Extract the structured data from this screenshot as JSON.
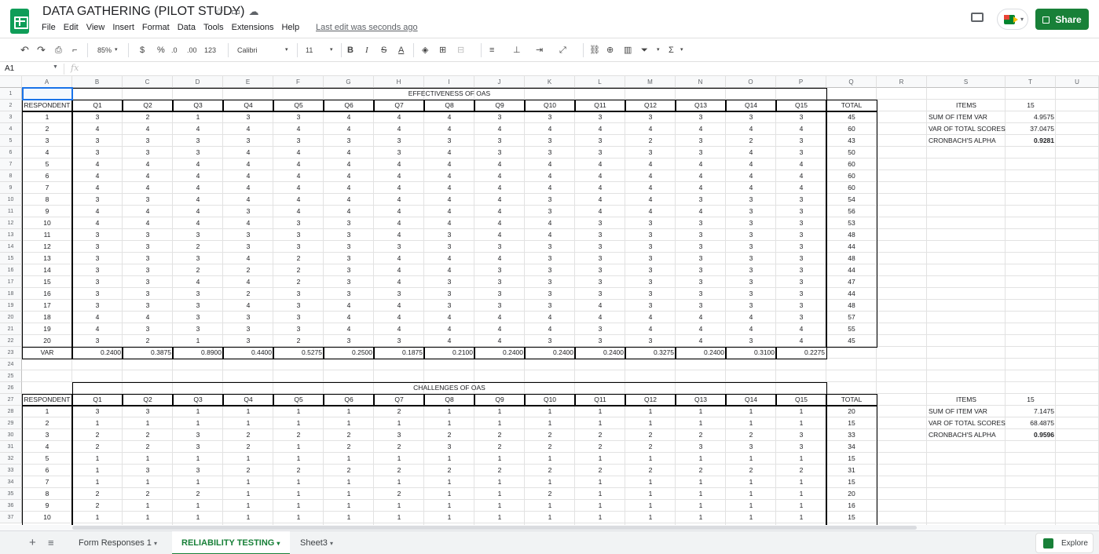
{
  "app": {
    "title": "DATA GATHERING (PILOT STUDY)",
    "menu": [
      "File",
      "Edit",
      "View",
      "Insert",
      "Format",
      "Data",
      "Tools",
      "Extensions",
      "Help"
    ],
    "last_edit": "Last edit was seconds ago",
    "share_label": "Share",
    "accent": "#188038"
  },
  "toolbar": {
    "zoom": "85%",
    "currency": "$",
    "percent": "%",
    "dec_less": ".0",
    "dec_more": ".00",
    "format_more": "123",
    "font": "Calibri",
    "font_size": "11"
  },
  "formula_bar": {
    "cell_ref": "A1",
    "fx": "fx"
  },
  "columns": [
    "A",
    "B",
    "C",
    "D",
    "E",
    "F",
    "G",
    "H",
    "I",
    "J",
    "K",
    "L",
    "M",
    "N",
    "O",
    "P",
    "Q",
    "R",
    "S",
    "T",
    "U"
  ],
  "rows": [
    "1",
    "2",
    "3",
    "4",
    "5",
    "6",
    "7",
    "8",
    "9",
    "10",
    "11",
    "12",
    "13",
    "14",
    "15",
    "16",
    "17",
    "18",
    "19",
    "20",
    "21",
    "22",
    "23",
    "24",
    "25",
    "26",
    "27",
    "28",
    "29",
    "30",
    "31",
    "32",
    "33",
    "34",
    "35",
    "36",
    "37"
  ],
  "table1": {
    "title": "EFFECTIVENESS OF OAS",
    "headers": [
      "RESPONDENT",
      "Q1",
      "Q2",
      "Q3",
      "Q4",
      "Q5",
      "Q6",
      "Q7",
      "Q8",
      "Q9",
      "Q10",
      "Q11",
      "Q12",
      "Q13",
      "Q14",
      "Q15",
      "TOTAL"
    ],
    "rows": [
      [
        "1",
        "3",
        "2",
        "1",
        "3",
        "3",
        "4",
        "4",
        "4",
        "3",
        "3",
        "3",
        "3",
        "3",
        "3",
        "3",
        "45"
      ],
      [
        "2",
        "4",
        "4",
        "4",
        "4",
        "4",
        "4",
        "4",
        "4",
        "4",
        "4",
        "4",
        "4",
        "4",
        "4",
        "4",
        "60"
      ],
      [
        "3",
        "3",
        "3",
        "3",
        "3",
        "3",
        "3",
        "3",
        "3",
        "3",
        "3",
        "3",
        "2",
        "3",
        "2",
        "3",
        "43"
      ],
      [
        "4",
        "3",
        "3",
        "3",
        "4",
        "4",
        "4",
        "3",
        "4",
        "3",
        "3",
        "3",
        "3",
        "3",
        "4",
        "3",
        "50"
      ],
      [
        "5",
        "4",
        "4",
        "4",
        "4",
        "4",
        "4",
        "4",
        "4",
        "4",
        "4",
        "4",
        "4",
        "4",
        "4",
        "4",
        "60"
      ],
      [
        "6",
        "4",
        "4",
        "4",
        "4",
        "4",
        "4",
        "4",
        "4",
        "4",
        "4",
        "4",
        "4",
        "4",
        "4",
        "4",
        "60"
      ],
      [
        "7",
        "4",
        "4",
        "4",
        "4",
        "4",
        "4",
        "4",
        "4",
        "4",
        "4",
        "4",
        "4",
        "4",
        "4",
        "4",
        "60"
      ],
      [
        "8",
        "3",
        "3",
        "4",
        "4",
        "4",
        "4",
        "4",
        "4",
        "4",
        "3",
        "4",
        "4",
        "3",
        "3",
        "3",
        "54"
      ],
      [
        "9",
        "4",
        "4",
        "4",
        "3",
        "4",
        "4",
        "4",
        "4",
        "4",
        "3",
        "4",
        "4",
        "4",
        "3",
        "3",
        "56"
      ],
      [
        "10",
        "4",
        "4",
        "4",
        "4",
        "3",
        "3",
        "4",
        "4",
        "4",
        "4",
        "3",
        "3",
        "3",
        "3",
        "3",
        "53"
      ],
      [
        "11",
        "3",
        "3",
        "3",
        "3",
        "3",
        "3",
        "4",
        "3",
        "4",
        "4",
        "3",
        "3",
        "3",
        "3",
        "3",
        "48"
      ],
      [
        "12",
        "3",
        "3",
        "2",
        "3",
        "3",
        "3",
        "3",
        "3",
        "3",
        "3",
        "3",
        "3",
        "3",
        "3",
        "3",
        "44"
      ],
      [
        "13",
        "3",
        "3",
        "3",
        "4",
        "2",
        "3",
        "4",
        "4",
        "4",
        "3",
        "3",
        "3",
        "3",
        "3",
        "3",
        "48"
      ],
      [
        "14",
        "3",
        "3",
        "2",
        "2",
        "2",
        "3",
        "4",
        "4",
        "3",
        "3",
        "3",
        "3",
        "3",
        "3",
        "3",
        "44"
      ],
      [
        "15",
        "3",
        "3",
        "4",
        "4",
        "2",
        "3",
        "4",
        "3",
        "3",
        "3",
        "3",
        "3",
        "3",
        "3",
        "3",
        "47"
      ],
      [
        "16",
        "3",
        "3",
        "3",
        "2",
        "3",
        "3",
        "3",
        "3",
        "3",
        "3",
        "3",
        "3",
        "3",
        "3",
        "3",
        "44"
      ],
      [
        "17",
        "3",
        "3",
        "3",
        "4",
        "3",
        "4",
        "4",
        "3",
        "3",
        "3",
        "4",
        "3",
        "3",
        "3",
        "3",
        "48"
      ],
      [
        "18",
        "4",
        "4",
        "3",
        "3",
        "3",
        "4",
        "4",
        "4",
        "4",
        "4",
        "4",
        "4",
        "4",
        "4",
        "3",
        "57"
      ],
      [
        "19",
        "4",
        "3",
        "3",
        "3",
        "3",
        "4",
        "4",
        "4",
        "4",
        "4",
        "3",
        "4",
        "4",
        "4",
        "4",
        "55"
      ],
      [
        "20",
        "3",
        "2",
        "1",
        "3",
        "2",
        "3",
        "3",
        "4",
        "4",
        "3",
        "3",
        "3",
        "4",
        "3",
        "4",
        "45"
      ]
    ],
    "var_label": "VAR",
    "var_values": [
      "0.2400",
      "0.3875",
      "0.8900",
      "0.4400",
      "0.5275",
      "0.2500",
      "0.1875",
      "0.2100",
      "0.2400",
      "0.2400",
      "0.2400",
      "0.3275",
      "0.2400",
      "0.3100",
      "0.2275"
    ]
  },
  "stats1": [
    {
      "label": "ITEMS",
      "value": "15"
    },
    {
      "label": "SUM OF ITEM VAR",
      "value": "4.9575"
    },
    {
      "label": "VAR OF TOTAL SCORES",
      "value": "37.0475"
    },
    {
      "label": "CRONBACH'S ALPHA",
      "value": "0.9281"
    }
  ],
  "table2": {
    "title": "CHALLENGES OF OAS",
    "headers": [
      "RESPONDENT",
      "Q1",
      "Q2",
      "Q3",
      "Q4",
      "Q5",
      "Q6",
      "Q7",
      "Q8",
      "Q9",
      "Q10",
      "Q11",
      "Q12",
      "Q13",
      "Q14",
      "Q15",
      "TOTAL"
    ],
    "rows": [
      [
        "1",
        "3",
        "3",
        "1",
        "1",
        "1",
        "1",
        "2",
        "1",
        "1",
        "1",
        "1",
        "1",
        "1",
        "1",
        "1",
        "20"
      ],
      [
        "2",
        "1",
        "1",
        "1",
        "1",
        "1",
        "1",
        "1",
        "1",
        "1",
        "1",
        "1",
        "1",
        "1",
        "1",
        "1",
        "15"
      ],
      [
        "3",
        "2",
        "2",
        "3",
        "2",
        "2",
        "2",
        "3",
        "2",
        "2",
        "2",
        "2",
        "2",
        "2",
        "2",
        "3",
        "33"
      ],
      [
        "4",
        "2",
        "2",
        "3",
        "2",
        "1",
        "2",
        "2",
        "3",
        "2",
        "2",
        "2",
        "2",
        "3",
        "3",
        "3",
        "34"
      ],
      [
        "5",
        "1",
        "1",
        "1",
        "1",
        "1",
        "1",
        "1",
        "1",
        "1",
        "1",
        "1",
        "1",
        "1",
        "1",
        "1",
        "15"
      ],
      [
        "6",
        "1",
        "3",
        "3",
        "2",
        "2",
        "2",
        "2",
        "2",
        "2",
        "2",
        "2",
        "2",
        "2",
        "2",
        "2",
        "31"
      ],
      [
        "7",
        "1",
        "1",
        "1",
        "1",
        "1",
        "1",
        "1",
        "1",
        "1",
        "1",
        "1",
        "1",
        "1",
        "1",
        "1",
        "15"
      ],
      [
        "8",
        "2",
        "2",
        "2",
        "1",
        "1",
        "1",
        "2",
        "1",
        "1",
        "2",
        "1",
        "1",
        "1",
        "1",
        "1",
        "20"
      ],
      [
        "9",
        "2",
        "1",
        "1",
        "1",
        "1",
        "1",
        "1",
        "1",
        "1",
        "1",
        "1",
        "1",
        "1",
        "1",
        "1",
        "16"
      ],
      [
        "10",
        "1",
        "1",
        "1",
        "1",
        "1",
        "1",
        "1",
        "1",
        "1",
        "1",
        "1",
        "1",
        "1",
        "1",
        "1",
        "15"
      ]
    ]
  },
  "stats2": [
    {
      "label": "ITEMS",
      "value": "15"
    },
    {
      "label": "SUM OF ITEM VAR",
      "value": "7.1475"
    },
    {
      "label": "VAR OF TOTAL SCORES",
      "value": "68.4875"
    },
    {
      "label": "CRONBACH'S ALPHA",
      "value": "0.9596"
    }
  ],
  "sheets": {
    "tabs": [
      "Form Responses 1",
      "RELIABILITY TESTING",
      "Sheet3"
    ],
    "active": "RELIABILITY TESTING",
    "explore_label": "Explore"
  }
}
